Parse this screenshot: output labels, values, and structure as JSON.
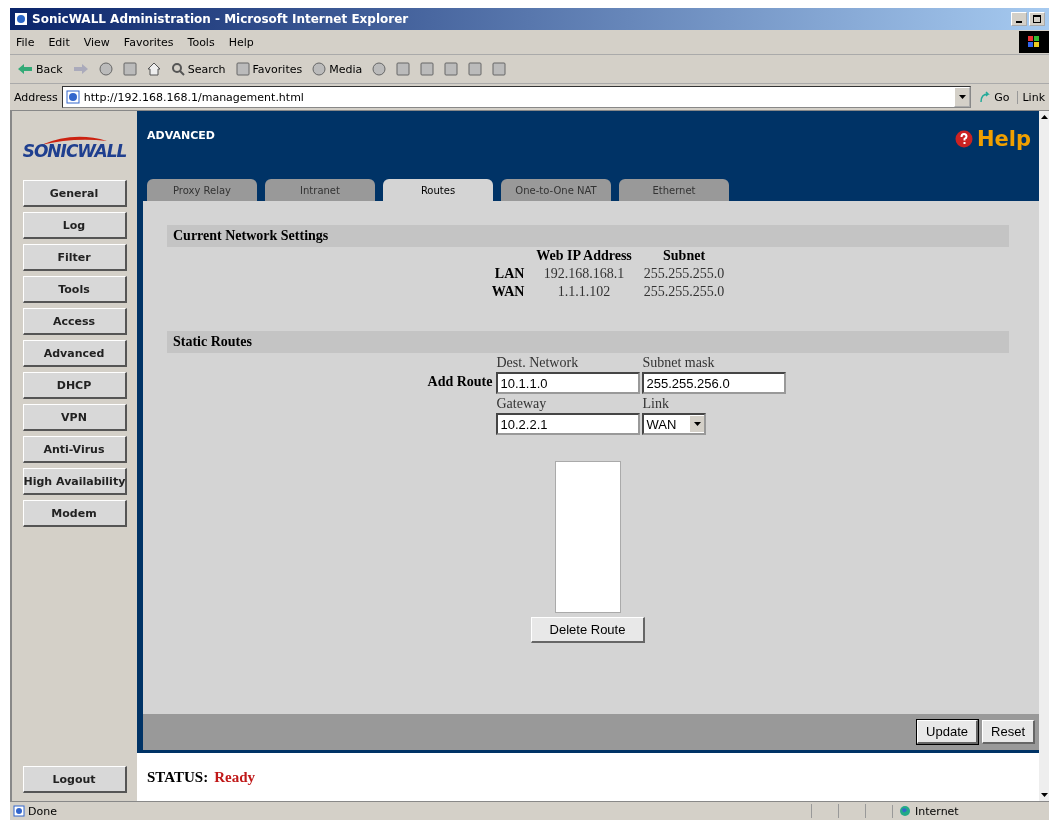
{
  "window": {
    "title": "SonicWALL Administration - Microsoft Internet Explorer"
  },
  "menu": [
    "File",
    "Edit",
    "View",
    "Favorites",
    "Tools",
    "Help"
  ],
  "toolbar": [
    {
      "kind": "back",
      "label": "Back"
    },
    {
      "kind": "forward"
    },
    {
      "kind": "stop"
    },
    {
      "kind": "refresh"
    },
    {
      "kind": "home"
    },
    {
      "kind": "search",
      "label": "Search"
    },
    {
      "kind": "favorites",
      "label": "Favorites"
    },
    {
      "kind": "media",
      "label": "Media"
    },
    {
      "kind": "history"
    },
    {
      "kind": "mail"
    },
    {
      "kind": "print"
    },
    {
      "kind": "edit"
    },
    {
      "kind": "discuss"
    },
    {
      "kind": "messenger"
    }
  ],
  "address": {
    "label": "Address",
    "value": "http://192.168.168.1/management.html",
    "go": "Go",
    "links": "Link"
  },
  "sidebar": {
    "logo": "SONICWALL",
    "items": [
      "General",
      "Log",
      "Filter",
      "Tools",
      "Access",
      "Advanced",
      "DHCP",
      "VPN",
      "Anti-Virus",
      "High Availability",
      "Modem"
    ],
    "logout": "Logout"
  },
  "header": {
    "title": "ADVANCED",
    "help": "Help"
  },
  "tabs": [
    {
      "label": "Proxy Relay",
      "selected": false
    },
    {
      "label": "Intranet",
      "selected": false
    },
    {
      "label": "Routes",
      "selected": true
    },
    {
      "label": "One-to-One NAT",
      "selected": false
    },
    {
      "label": "Ethernet",
      "selected": false
    }
  ],
  "current_settings": {
    "title": "Current Network Settings",
    "columns": [
      "Web IP Address",
      "Subnet"
    ],
    "rows": [
      {
        "label": "LAN",
        "ip": "192.168.168.1",
        "subnet": "255.255.255.0"
      },
      {
        "label": "WAN",
        "ip": "1.1.1.102",
        "subnet": "255.255.255.0"
      }
    ]
  },
  "static_routes": {
    "title": "Static Routes",
    "add_label": "Add Route",
    "dest": {
      "label": "Dest. Network",
      "value": "10.1.1.0"
    },
    "mask": {
      "label": "Subnet mask",
      "value": "255.255.256.0"
    },
    "gateway": {
      "label": "Gateway",
      "value": "10.2.2.1"
    },
    "link": {
      "label": "Link",
      "value": "WAN"
    },
    "delete": "Delete Route"
  },
  "buttons": [
    "Update",
    "Reset"
  ],
  "status": {
    "label": "STATUS:",
    "value": "Ready"
  },
  "status_bar": {
    "text": "Done",
    "zone": "Internet"
  }
}
